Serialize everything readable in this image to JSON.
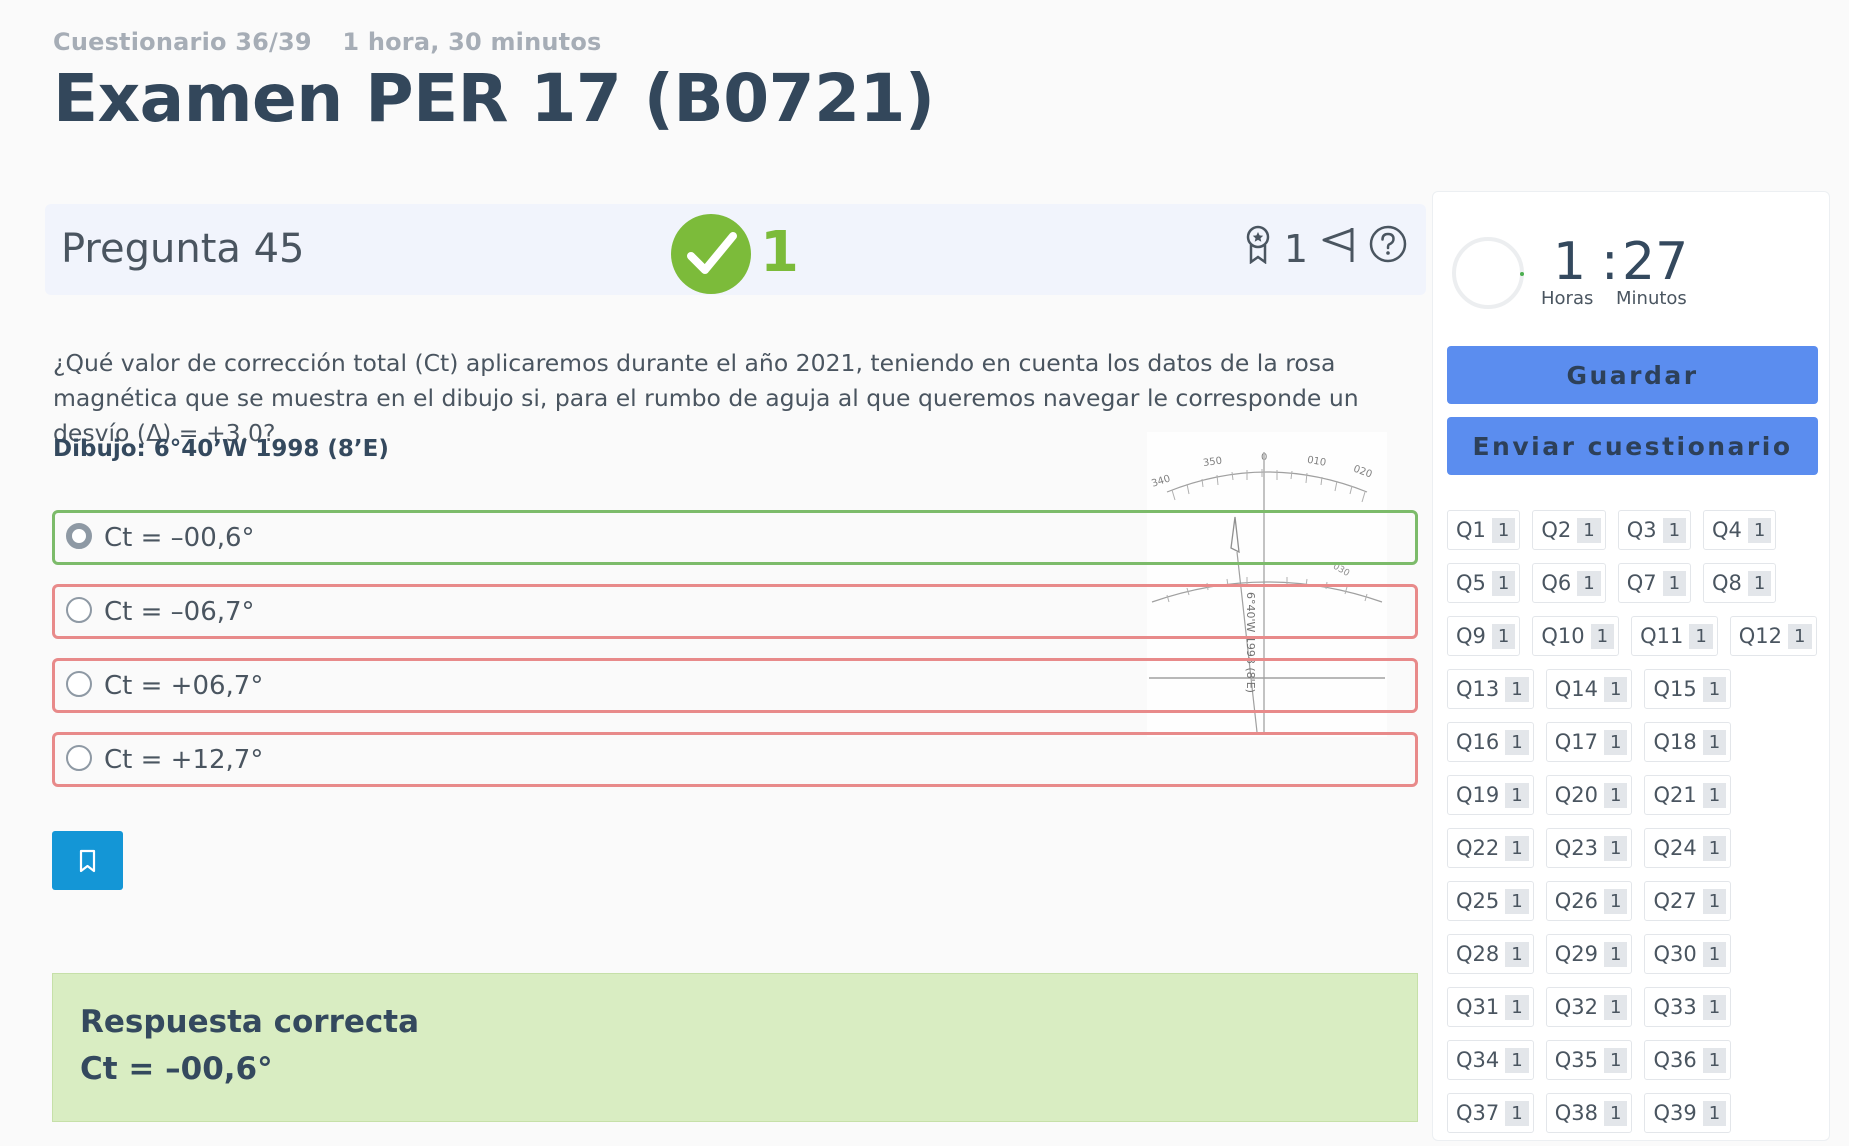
{
  "header": {
    "quiz_progress": "Cuestionario 36/39",
    "duration": "1 hora, 30 minutos",
    "title": "Examen PER 17 (B0721)"
  },
  "question": {
    "title": "Pregunta 45",
    "score": "1",
    "points": "1",
    "text": "¿Qué valor de corrección total (Ct) aplicaremos durante el año 2021, teniendo en cuenta los datos de la rosa magnética que se muestra en el dibujo si, para el rumbo de aguja al que queremos navegar le corresponde un desvío (Δ) = +3,0?",
    "drawing_label": "Dibujo: 6°40’W 1998 (8’E)",
    "drawing": {
      "ticks": [
        "340",
        "350",
        "0",
        "010",
        "020",
        "030"
      ],
      "annotation": "6°40'W 1998 (8'E)"
    },
    "options": [
      {
        "label": "Ct = –00,6°",
        "selected": true,
        "correct": true
      },
      {
        "label": "Ct = –06,7°",
        "selected": false,
        "correct": false
      },
      {
        "label": "Ct = +06,7°",
        "selected": false,
        "correct": false
      },
      {
        "label": "Ct = +12,7°",
        "selected": false,
        "correct": false
      }
    ],
    "icons": [
      "award-icon",
      "flag-icon",
      "help-icon",
      "bookmark-icon",
      "check-icon"
    ]
  },
  "answer": {
    "heading": "Respuesta correcta",
    "value": "Ct = –00,6°"
  },
  "sidebar": {
    "timer": {
      "hours": "1",
      "colon": ":",
      "minutes": "27",
      "hours_label": "Horas",
      "minutes_label": "Minutos"
    },
    "save_label": "Guardar",
    "submit_label": "Enviar cuestionario",
    "questions": [
      [
        [
          "Q1",
          "1"
        ],
        [
          "Q2",
          "1"
        ],
        [
          "Q3",
          "1"
        ],
        [
          "Q4",
          "1"
        ]
      ],
      [
        [
          "Q5",
          "1"
        ],
        [
          "Q6",
          "1"
        ],
        [
          "Q7",
          "1"
        ],
        [
          "Q8",
          "1"
        ]
      ],
      [
        [
          "Q9",
          "1"
        ],
        [
          "Q10",
          "1"
        ],
        [
          "Q11",
          "1"
        ],
        [
          "Q12",
          "1"
        ]
      ],
      [
        [
          "Q13",
          "1"
        ],
        [
          "Q14",
          "1"
        ],
        [
          "Q15",
          "1"
        ]
      ],
      [
        [
          "Q16",
          "1"
        ],
        [
          "Q17",
          "1"
        ],
        [
          "Q18",
          "1"
        ]
      ],
      [
        [
          "Q19",
          "1"
        ],
        [
          "Q20",
          "1"
        ],
        [
          "Q21",
          "1"
        ]
      ],
      [
        [
          "Q22",
          "1"
        ],
        [
          "Q23",
          "1"
        ],
        [
          "Q24",
          "1"
        ]
      ],
      [
        [
          "Q25",
          "1"
        ],
        [
          "Q26",
          "1"
        ],
        [
          "Q27",
          "1"
        ]
      ],
      [
        [
          "Q28",
          "1"
        ],
        [
          "Q29",
          "1"
        ],
        [
          "Q30",
          "1"
        ]
      ],
      [
        [
          "Q31",
          "1"
        ],
        [
          "Q32",
          "1"
        ],
        [
          "Q33",
          "1"
        ]
      ],
      [
        [
          "Q34",
          "1"
        ],
        [
          "Q35",
          "1"
        ],
        [
          "Q36",
          "1"
        ]
      ],
      [
        [
          "Q37",
          "1"
        ],
        [
          "Q38",
          "1"
        ],
        [
          "Q39",
          "1"
        ]
      ]
    ]
  },
  "colors": {
    "accent_blue": "#5b8def",
    "bookmark_blue": "#1496d6",
    "correct_green": "#7cbb3a",
    "wrong_red": "#e88a8a",
    "answer_bg": "#d9edc2"
  }
}
